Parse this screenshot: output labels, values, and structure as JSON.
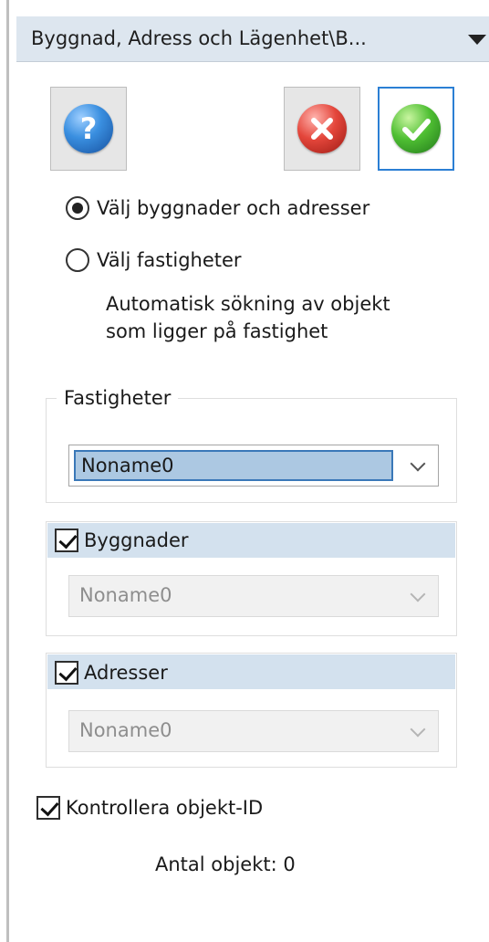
{
  "panel": {
    "title": "Byggnad, Adress och Lägenhet\\B...",
    "dropdown_icon": "chevron-down-icon"
  },
  "toolbar": {
    "help_icon": "help-icon",
    "cancel_icon": "cancel-icon",
    "ok_icon": "ok-icon",
    "colors": {
      "help": "#2f86d9",
      "cancel": "#e2453a",
      "ok": "#4cbb34",
      "active_border": "#2b7fd4"
    }
  },
  "selection_mode": {
    "options": [
      {
        "label": "Välj byggnader och adresser",
        "checked": true
      },
      {
        "label": "Välj fastigheter",
        "checked": false
      }
    ],
    "description_lines": [
      "Automatisk sökning av objekt",
      "som ligger på fastighet"
    ]
  },
  "fastigheter": {
    "legend": "Fastigheter",
    "selected_value": "Noname0"
  },
  "byggnader": {
    "label": "Byggnader",
    "checked": true,
    "value": "Noname0"
  },
  "adresser": {
    "label": "Adresser",
    "checked": true,
    "value": "Noname0"
  },
  "kontrollera": {
    "label": "Kontrollera objekt-ID",
    "checked": true
  },
  "status": {
    "count_text": "Antal objekt: 0"
  }
}
